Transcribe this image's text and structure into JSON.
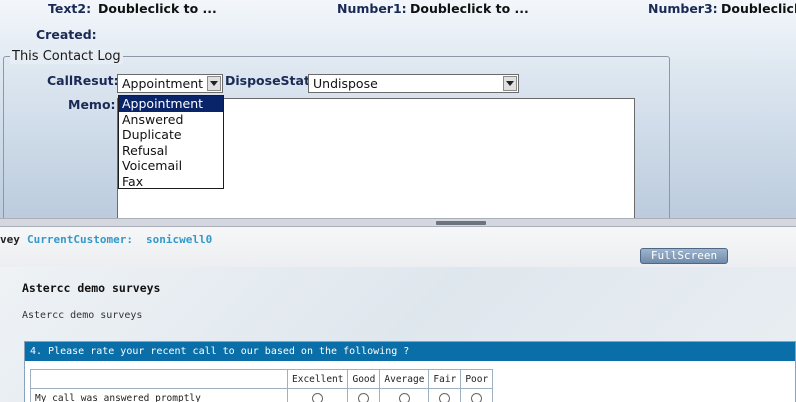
{
  "header_fields": {
    "text2_label": "Text2:",
    "text2_value": "Doubleclick to ...",
    "number1_label": "Number1:",
    "number1_value": "Doubleclick to ...",
    "number3_label": "Number3:",
    "number3_value": "Doubleclick",
    "created_label": "Created:"
  },
  "contact_log": {
    "legend": "This Contact Log",
    "callresult_label": "CallResut:",
    "callresult_value": "Appointment",
    "dispose_label": "DisposeStatu",
    "dispose_value": "Undispose",
    "memo_label": "Memo:",
    "dropdown_options": [
      "Appointment",
      "Answered",
      "Duplicate",
      "Refusal",
      "Voicemail",
      "Fax"
    ],
    "dropdown_selected_index": 0
  },
  "survey": {
    "tab_fragment": "vey",
    "customer_label": "CurrentCustomer:",
    "customer_value": "sonicwell0",
    "fullscreen_label": "FullScreen",
    "title": "Astercc demo surveys",
    "description": "Astercc demo surveys",
    "question": "4. Please rate your recent call to our based on the following ?",
    "rating_columns": [
      "Excellent",
      "Good",
      "Average",
      "Fair",
      "Poor"
    ],
    "rating_rows": [
      "My call was answered promptly"
    ]
  },
  "colors": {
    "dropdown_highlight": "#0a246a",
    "question_header": "#0a6ea8",
    "customer_text": "#3399cc"
  }
}
